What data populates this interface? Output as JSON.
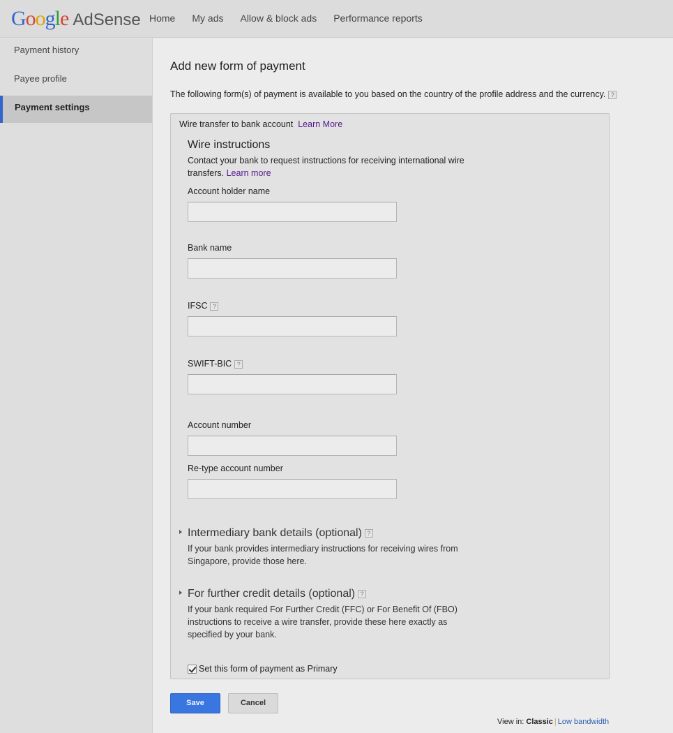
{
  "header": {
    "logo_google": [
      "G",
      "o",
      "o",
      "g",
      "l",
      "e"
    ],
    "logo_colors": [
      "#3366cc",
      "#d14836",
      "#e0a300",
      "#3366cc",
      "#2a9d3a",
      "#d14836"
    ],
    "logo_product": "AdSense",
    "nav": [
      "Home",
      "My ads",
      "Allow & block ads",
      "Performance reports"
    ]
  },
  "sidebar": {
    "items": [
      {
        "label": "Payment history",
        "active": false
      },
      {
        "label": "Payee profile",
        "active": false
      },
      {
        "label": "Payment settings",
        "active": true
      }
    ]
  },
  "main": {
    "title": "Add new form of payment",
    "intro": "The following form(s) of payment is available to you based on the country of the profile address and the currency.",
    "help_glyph": "?",
    "panel": {
      "method": "Wire transfer to bank account",
      "method_link": "Learn More",
      "section_title": "Wire instructions",
      "section_desc": "Contact your bank to request instructions for receiving international wire transfers.",
      "section_link": "Learn more",
      "fields": [
        {
          "label": "Account holder name",
          "value": "",
          "help": false
        },
        {
          "label": "Bank name",
          "value": "",
          "help": false
        },
        {
          "label": "IFSC",
          "value": "",
          "help": true
        },
        {
          "label": "SWIFT-BIC",
          "value": "",
          "help": true
        },
        {
          "label": "Account number",
          "value": "",
          "help": false
        },
        {
          "label": "Re-type account number",
          "value": "",
          "help": false
        }
      ],
      "expanders": [
        {
          "title": "Intermediary bank details (optional)",
          "desc": "If your bank provides intermediary instructions for receiving wires from Singapore, provide those here.",
          "expanded": false
        },
        {
          "title": "For further credit details (optional)",
          "desc": "If your bank required For Further Credit (FFC) or For Benefit Of (FBO) instructions to receive a wire transfer, provide these here exactly as specified by your bank.",
          "expanded": false
        }
      ],
      "primary_label": "Set this form of payment as Primary",
      "primary_checked": true
    },
    "buttons": {
      "save": "Save",
      "cancel": "Cancel"
    },
    "footer": {
      "view_in": "View in:",
      "classic": "Classic",
      "separator": "|",
      "low_bandwidth": "Low bandwidth"
    }
  }
}
